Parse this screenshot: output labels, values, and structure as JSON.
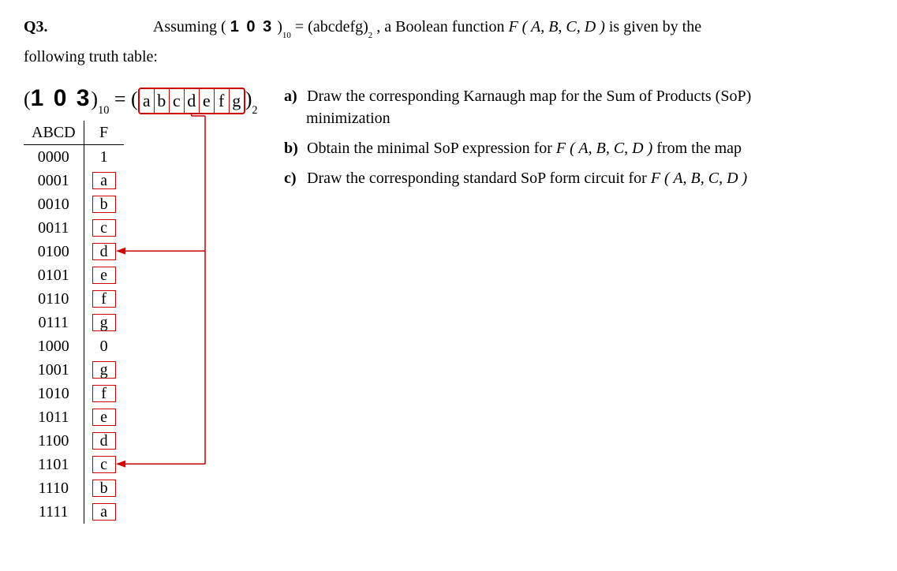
{
  "header": {
    "q_label": "Q3.",
    "assuming": "Assuming",
    "hand_number_top": "1 0 3",
    "eq_rhs": "abcdefg",
    "tail": ", a Boolean function",
    "func": "F ( A, B, C, D )",
    "tail2": "is given by the",
    "line2": "following truth table:"
  },
  "equation": {
    "hand": "1 0 3",
    "sub10": "10",
    "letters": [
      "a",
      "b",
      "c",
      "d",
      "e",
      "f",
      "g"
    ],
    "sub2": "2"
  },
  "truth_table": {
    "head_abcd": "ABCD",
    "head_f": "F",
    "rows": [
      {
        "abcd": "0000",
        "f": "1",
        "box": false
      },
      {
        "abcd": "0001",
        "f": "a",
        "box": true
      },
      {
        "abcd": "0010",
        "f": "b",
        "box": true
      },
      {
        "abcd": "0011",
        "f": "c",
        "box": true
      },
      {
        "abcd": "0100",
        "f": "d",
        "box": true
      },
      {
        "abcd": "0101",
        "f": "e",
        "box": true
      },
      {
        "abcd": "0110",
        "f": "f",
        "box": true
      },
      {
        "abcd": "0111",
        "f": "g",
        "box": true
      },
      {
        "abcd": "1000",
        "f": "0",
        "box": false
      },
      {
        "abcd": "1001",
        "f": "g",
        "box": true
      },
      {
        "abcd": "1010",
        "f": "f",
        "box": true
      },
      {
        "abcd": "1011",
        "f": "e",
        "box": true
      },
      {
        "abcd": "1100",
        "f": "d",
        "box": true
      },
      {
        "abcd": "1101",
        "f": "c",
        "box": true
      },
      {
        "abcd": "1110",
        "f": "b",
        "box": true
      },
      {
        "abcd": "1111",
        "f": "a",
        "box": true
      }
    ]
  },
  "tasks": {
    "a_lbl": "a)",
    "a_txt1": "Draw the corresponding Karnaugh map for the Sum of Products (SoP)",
    "a_txt2": "minimization",
    "b_lbl": "b)",
    "b_txt": "Obtain the minimal SoP expression for",
    "b_func": "F ( A, B, C, D )",
    "b_tail": "from the map",
    "c_lbl": "c)",
    "c_txt": "Draw the corresponding standard SoP form circuit for",
    "c_func": "F ( A, B, C, D )"
  }
}
